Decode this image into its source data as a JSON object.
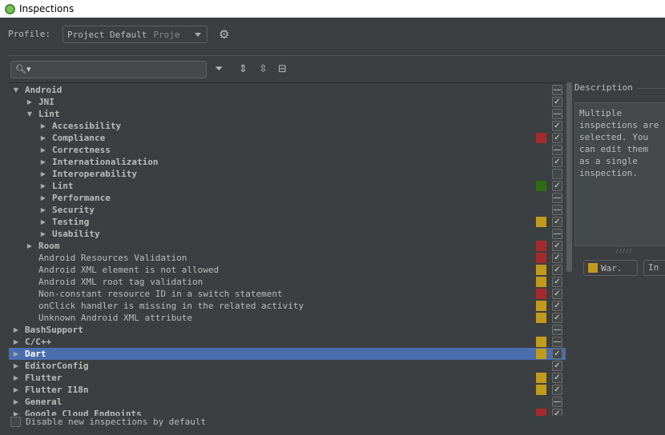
{
  "window": {
    "title": "Inspections"
  },
  "profile": {
    "label": "Profile:",
    "value": "Project Default",
    "scope": "Proje"
  },
  "search": {
    "placeholder": ""
  },
  "toolbar": {
    "filter": "filter-icon",
    "expand": "expand-all-icon",
    "collapse": "collapse-all-icon",
    "reset": "reset-icon"
  },
  "colors": {
    "error": "#a52a2a",
    "warning": "#c29a1c",
    "green": "#2b6e16",
    "selection": "#4b6eaf"
  },
  "tree": [
    {
      "label": "Android",
      "level": 0,
      "arrow": "down",
      "group": true,
      "state": "partial"
    },
    {
      "label": "JNI",
      "level": 1,
      "arrow": "right",
      "group": true,
      "state": "checked"
    },
    {
      "label": "Lint",
      "level": 1,
      "arrow": "down",
      "group": true,
      "state": "partial"
    },
    {
      "label": "Accessibility",
      "level": 2,
      "arrow": "right",
      "group": true,
      "state": "checked"
    },
    {
      "label": "Compliance",
      "level": 2,
      "arrow": "right",
      "group": true,
      "severity": "error",
      "state": "checked"
    },
    {
      "label": "Correctness",
      "level": 2,
      "arrow": "right",
      "group": true,
      "state": "partial"
    },
    {
      "label": "Internationalization",
      "level": 2,
      "arrow": "right",
      "group": true,
      "state": "checked"
    },
    {
      "label": "Interoperability",
      "level": 2,
      "arrow": "right",
      "group": true,
      "state": "unchecked"
    },
    {
      "label": "Lint",
      "level": 2,
      "arrow": "right",
      "group": true,
      "severity": "green",
      "state": "checked"
    },
    {
      "label": "Performance",
      "level": 2,
      "arrow": "right",
      "group": true,
      "state": "partial"
    },
    {
      "label": "Security",
      "level": 2,
      "arrow": "right",
      "group": true,
      "state": "partial"
    },
    {
      "label": "Testing",
      "level": 2,
      "arrow": "right",
      "group": true,
      "severity": "warning",
      "state": "checked"
    },
    {
      "label": "Usability",
      "level": 2,
      "arrow": "right",
      "group": true,
      "state": "partial"
    },
    {
      "label": "Room",
      "level": 1,
      "arrow": "right",
      "group": true,
      "severity": "error",
      "state": "checked"
    },
    {
      "label": "Android Resources Validation",
      "level": 1,
      "severity": "error",
      "state": "checked"
    },
    {
      "label": "Android XML element is not allowed",
      "level": 1,
      "severity": "warning",
      "state": "checked"
    },
    {
      "label": "Android XML root tag validation",
      "level": 1,
      "severity": "warning",
      "state": "checked"
    },
    {
      "label": "Non-constant resource ID in a switch statement",
      "level": 1,
      "severity": "error",
      "state": "checked"
    },
    {
      "label": "onClick handler is missing in the related activity",
      "level": 1,
      "severity": "warning",
      "state": "checked"
    },
    {
      "label": "Unknown Android XML attribute",
      "level": 1,
      "severity": "warning",
      "state": "checked"
    },
    {
      "label": "BashSupport",
      "level": 0,
      "arrow": "right",
      "group": true,
      "state": "partial"
    },
    {
      "label": "C/C++",
      "level": 0,
      "arrow": "right",
      "group": true,
      "severity": "warning",
      "state": "partial"
    },
    {
      "label": "Dart",
      "level": 0,
      "arrow": "right",
      "group": true,
      "severity": "warning",
      "state": "checked",
      "selected": true
    },
    {
      "label": "EditorConfig",
      "level": 0,
      "arrow": "right",
      "group": true,
      "state": "checked"
    },
    {
      "label": "Flutter",
      "level": 0,
      "arrow": "right",
      "group": true,
      "severity": "warning",
      "state": "checked"
    },
    {
      "label": "Flutter I18n",
      "level": 0,
      "arrow": "right",
      "group": true,
      "severity": "warning",
      "state": "checked"
    },
    {
      "label": "General",
      "level": 0,
      "arrow": "right",
      "group": true,
      "state": "partial"
    },
    {
      "label": "Google Cloud Endpoints",
      "level": 0,
      "arrow": "right",
      "group": true,
      "severity": "error",
      "state": "checked"
    }
  ],
  "description": {
    "title": "Description",
    "text": "Multiple\ninspections are\nselected. You\ncan edit them\nas a single\ninspection."
  },
  "severity_combo": {
    "value": "War."
  },
  "scope_combo": {
    "value": "In"
  },
  "footer": {
    "disable_label": "Disable new inspections by default"
  }
}
